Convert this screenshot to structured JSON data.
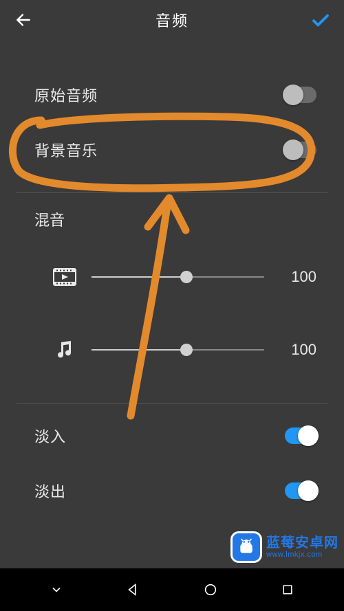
{
  "header": {
    "title": "音频",
    "back_icon": "back-arrow-icon",
    "confirm_icon": "check-icon"
  },
  "toggles": {
    "original_audio": {
      "label": "原始音频",
      "value": false
    },
    "background_music": {
      "label": "背景音乐",
      "value": false
    }
  },
  "mix": {
    "title": "混音",
    "video": {
      "icon": "film-icon",
      "value": 100,
      "display": "100",
      "percent": 55
    },
    "music": {
      "icon": "music-note-icon",
      "value": 100,
      "display": "100",
      "percent": 55
    }
  },
  "fade": {
    "fade_in": {
      "label": "淡入",
      "value": true
    },
    "fade_out": {
      "label": "淡出",
      "value": true
    }
  },
  "colors": {
    "accent": "#2196f3",
    "background": "#3a3a3a",
    "annotation": "#e38a2c"
  },
  "watermark": {
    "line1": "蓝莓安卓网",
    "line2": "www.lmkjx.com"
  },
  "navbar": {
    "menu_icon": "menu-chevron-icon",
    "back_icon": "nav-back-icon",
    "home_icon": "nav-home-icon",
    "recent_icon": "nav-recent-icon"
  }
}
